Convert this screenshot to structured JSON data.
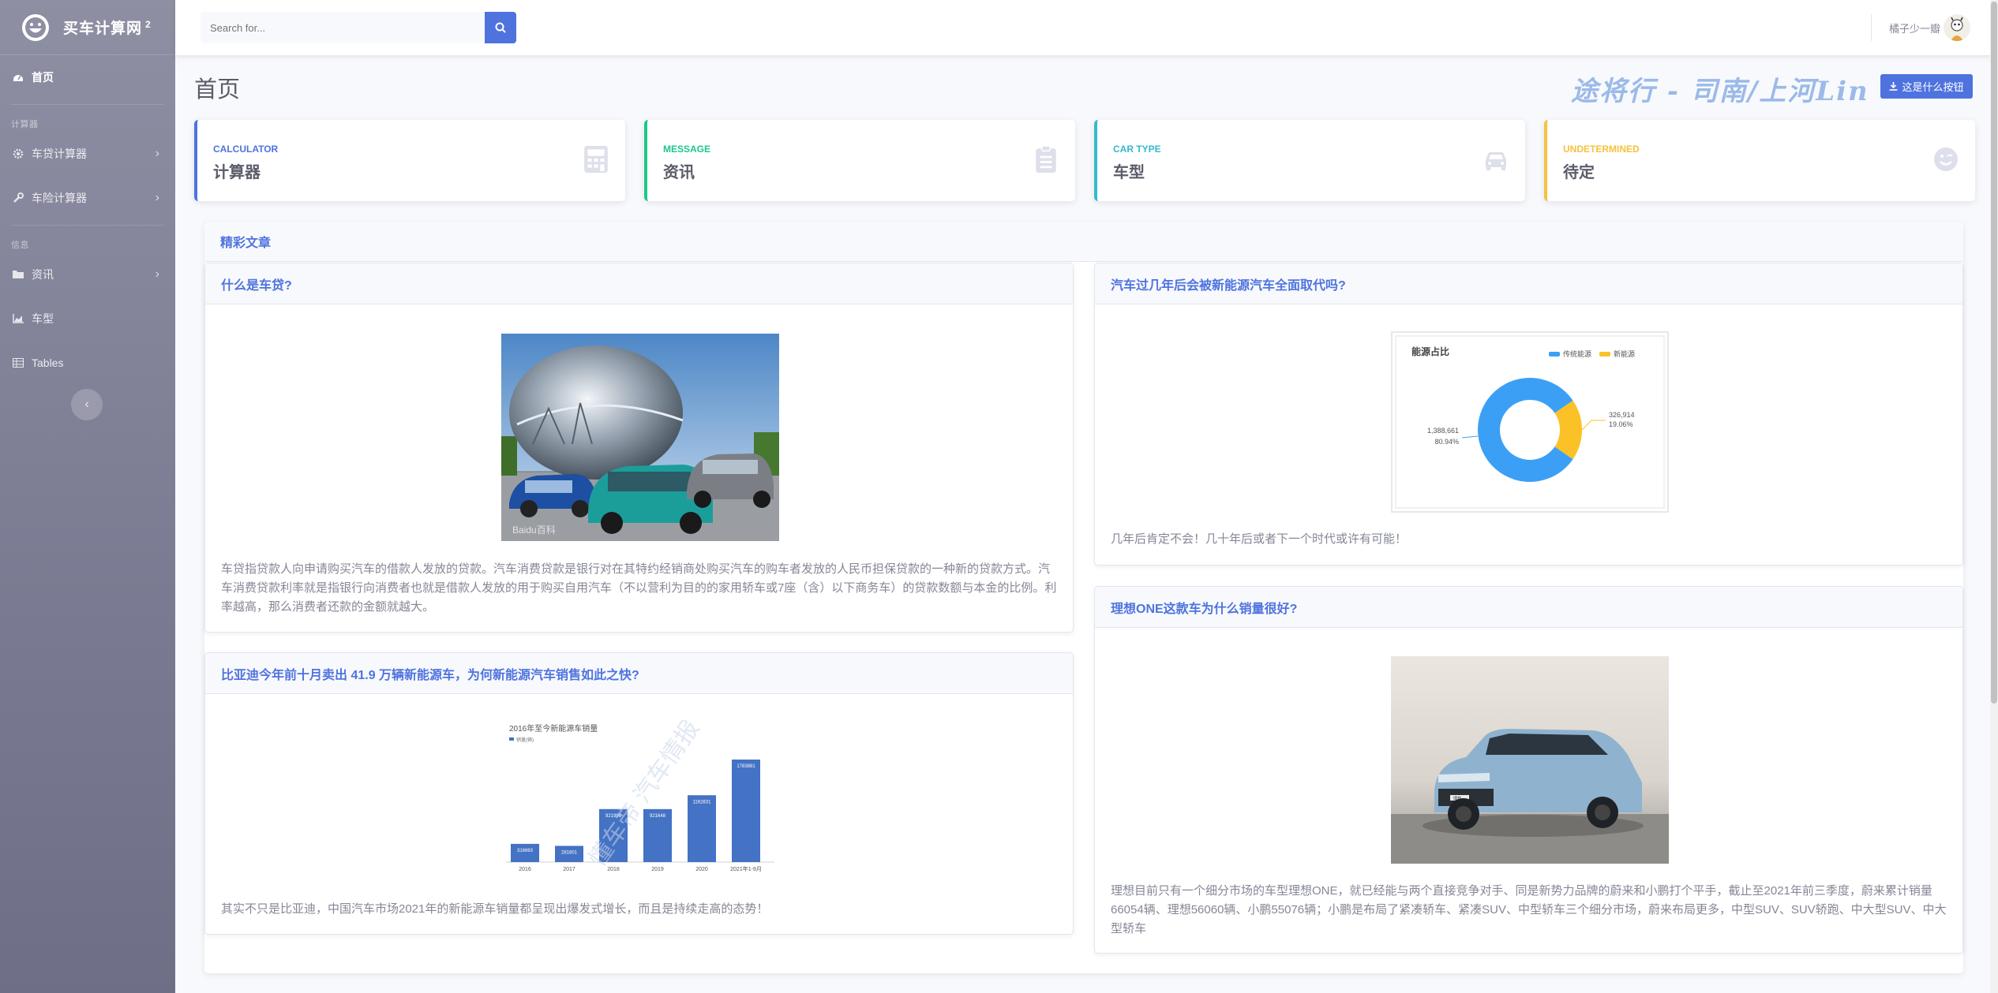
{
  "app": {
    "title": "买车计算网",
    "version": "2"
  },
  "sidebar": {
    "home": "首页",
    "heading_calc": "计算器",
    "loan_calc": "车贷计算器",
    "insurance_calc": "车险计算器",
    "heading_info": "信息",
    "news": "资讯",
    "car_models": "车型",
    "tables": "Tables"
  },
  "topbar": {
    "search_placeholder": "Search for...",
    "user_name": "橘子少一瓣"
  },
  "page": {
    "title": "首页",
    "banner": "途将行 - 司南/上河Lin",
    "button": "这是什么按钮"
  },
  "stats": [
    {
      "label": "CALCULATOR",
      "value": "计算器",
      "color": "#4e73df",
      "icon": "calculator-icon"
    },
    {
      "label": "MESSAGE",
      "value": "资讯",
      "color": "#1cc88a",
      "icon": "clipboard-icon"
    },
    {
      "label": "CAR TYPE",
      "value": "车型",
      "color": "#36b9cc",
      "icon": "car-icon"
    },
    {
      "label": "UNDETERMINED",
      "value": "待定",
      "color": "#f6c23e",
      "icon": "smile-icon"
    }
  ],
  "articles_section": {
    "title": "精彩文章"
  },
  "articles": {
    "loan": {
      "title": "什么是车贷?",
      "image_watermark": "Baidu百科",
      "text": "车贷指贷款人向申请购买汽车的借款人发放的贷款。汽车消费贷款是银行对在其特约经销商处购买汽车的购车者发放的人民币担保贷款的一种新的贷款方式。汽车消费贷款利率就是指银行向消费者也就是借款人发放的用于购买自用汽车（不以营利为目的的家用轿车或7座（含）以下商务车）的贷款数额与本金的比例。利率越高，那么消费者还款的金额就越大。"
    },
    "byd": {
      "title": "比亚迪今年前十月卖出 41.9 万辆新能源车，为何新能源汽车销售如此之快?",
      "text": "其实不只是比亚迪，中国汽车市场2021年的新能源车销量都呈现出爆发式增长，而且是持续走高的态势！"
    },
    "ev": {
      "title": "汽车过几年后会被新能源汽车全面取代吗?",
      "text": "几年后肯定不会！几十年后或者下一个时代或许有可能！"
    },
    "lixiang": {
      "title": "理想ONE这款车为什么销量很好?",
      "text": "理想目前只有一个细分市场的车型理想ONE，就已经能与两个直接竞争对手、同是新势力品牌的蔚来和小鹏打个平手，截止至2021年前三季度，蔚来累计销量66054辆、理想56060辆、小鹏55076辆；小鹏是布局了紧凑轿车、紧凑SUV、中型轿车三个细分市场，蔚来布局更多，中型SUV、SUV轿跑、中大型SUV、中大型轿车",
      "plate": "理想"
    }
  },
  "chart_data": [
    {
      "type": "bar",
      "title": "2016年至今新能源车销量",
      "legend": "销量(辆)",
      "categories": [
        "2016",
        "2017",
        "2018",
        "2019",
        "2020",
        "2021年1-9月"
      ],
      "values": [
        316863,
        281801,
        921998,
        921648,
        1162831,
        1783881
      ],
      "value_labels": [
        "316863",
        "281801",
        "921998",
        "921648",
        "1162831",
        "1783881"
      ],
      "watermark": "懂车帝 汽车情报",
      "color": "#4472c4"
    },
    {
      "type": "pie",
      "title": "能源占比",
      "legend": [
        "传统能源",
        "新能源"
      ],
      "values": [
        1388661,
        326914
      ],
      "value_labels": [
        "1,388,661",
        "326,914"
      ],
      "percent_labels": [
        "80.94%",
        "19.06%"
      ],
      "colors": [
        "#3ba0f5",
        "#fac227"
      ]
    }
  ]
}
